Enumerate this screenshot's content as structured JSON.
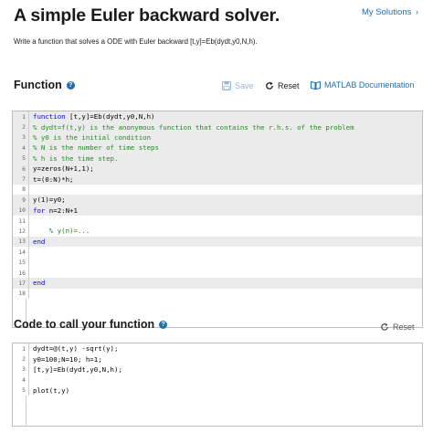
{
  "header": {
    "title": "A simple Euler backward solver.",
    "my_solutions_label": "My Solutions",
    "my_solutions_chevron": "›"
  },
  "description": "Write a function that solves a ODE with Euler backward [t,y]=Eb(dydt,y0,N,h).",
  "function_section": {
    "title": "Function",
    "help_icon": "?",
    "save_label": "Save",
    "reset_label": "Reset",
    "doc_label": "MATLAB Documentation",
    "lines": [
      {
        "no": "1",
        "segments": [
          {
            "t": "function",
            "c": "kw"
          },
          {
            "t": " [t,y]=Eb(dydt,y0,N,h)",
            "c": "tx"
          }
        ],
        "locked": true
      },
      {
        "no": "2",
        "segments": [
          {
            "t": "% dydt=f(t,y) is the anonymous function that contains the r.h.s. of the problem",
            "c": "cm"
          }
        ],
        "locked": true
      },
      {
        "no": "3",
        "segments": [
          {
            "t": "% y0 is the initial condition",
            "c": "cm"
          }
        ],
        "locked": true
      },
      {
        "no": "4",
        "segments": [
          {
            "t": "% N is the number of time steps",
            "c": "cm"
          }
        ],
        "locked": true
      },
      {
        "no": "5",
        "segments": [
          {
            "t": "% h is the time step.",
            "c": "cm"
          }
        ],
        "locked": true
      },
      {
        "no": "6",
        "segments": [
          {
            "t": "y=zeros(N+1,1);",
            "c": "tx"
          }
        ],
        "locked": true
      },
      {
        "no": "7",
        "segments": [
          {
            "t": "t=(0:N)*h;",
            "c": "tx"
          }
        ],
        "locked": true
      },
      {
        "no": "8",
        "segments": [
          {
            "t": "",
            "c": "tx"
          }
        ],
        "locked": false
      },
      {
        "no": "9",
        "segments": [
          {
            "t": "y(1)=y0;",
            "c": "tx"
          }
        ],
        "locked": true
      },
      {
        "no": "10",
        "segments": [
          {
            "t": "for",
            "c": "kw"
          },
          {
            "t": " n=2:N+1",
            "c": "tx"
          }
        ],
        "locked": true
      },
      {
        "no": "11",
        "segments": [
          {
            "t": "",
            "c": "tx"
          }
        ],
        "locked": false
      },
      {
        "no": "12",
        "segments": [
          {
            "t": "    % y(n)=...",
            "c": "cm"
          }
        ],
        "locked": false
      },
      {
        "no": "13",
        "segments": [
          {
            "t": "end",
            "c": "kw"
          }
        ],
        "locked": true
      },
      {
        "no": "14",
        "segments": [
          {
            "t": "",
            "c": "tx"
          }
        ],
        "locked": false
      },
      {
        "no": "15",
        "segments": [
          {
            "t": "",
            "c": "tx"
          }
        ],
        "locked": false
      },
      {
        "no": "16",
        "segments": [
          {
            "t": "",
            "c": "tx"
          }
        ],
        "locked": false
      },
      {
        "no": "17",
        "segments": [
          {
            "t": "end",
            "c": "kw"
          }
        ],
        "locked": true
      },
      {
        "no": "18",
        "segments": [
          {
            "t": "",
            "c": "tx"
          }
        ],
        "locked": false
      }
    ]
  },
  "call_section": {
    "title": "Code to call your function",
    "help_icon": "?",
    "reset_label": "Reset",
    "lines": [
      {
        "no": "1",
        "segments": [
          {
            "t": "dydt=@(t,y) -sqrt(y);",
            "c": "tx"
          }
        ],
        "locked": false
      },
      {
        "no": "2",
        "segments": [
          {
            "t": "y0=100;N=10; h=1;",
            "c": "tx"
          }
        ],
        "locked": false
      },
      {
        "no": "3",
        "segments": [
          {
            "t": "[t,y]=Eb(dydt,y0,N,h);",
            "c": "tx"
          }
        ],
        "locked": false
      },
      {
        "no": "4",
        "segments": [
          {
            "t": "",
            "c": "tx"
          }
        ],
        "locked": false
      },
      {
        "no": "5",
        "segments": [
          {
            "t": "plot(t,y)",
            "c": "tx"
          }
        ],
        "locked": false
      }
    ]
  },
  "colors": {
    "link": "#1f6fb2",
    "keyword": "#0000ff",
    "comment": "#228b22",
    "locked_line_bg": "#ebebeb"
  }
}
